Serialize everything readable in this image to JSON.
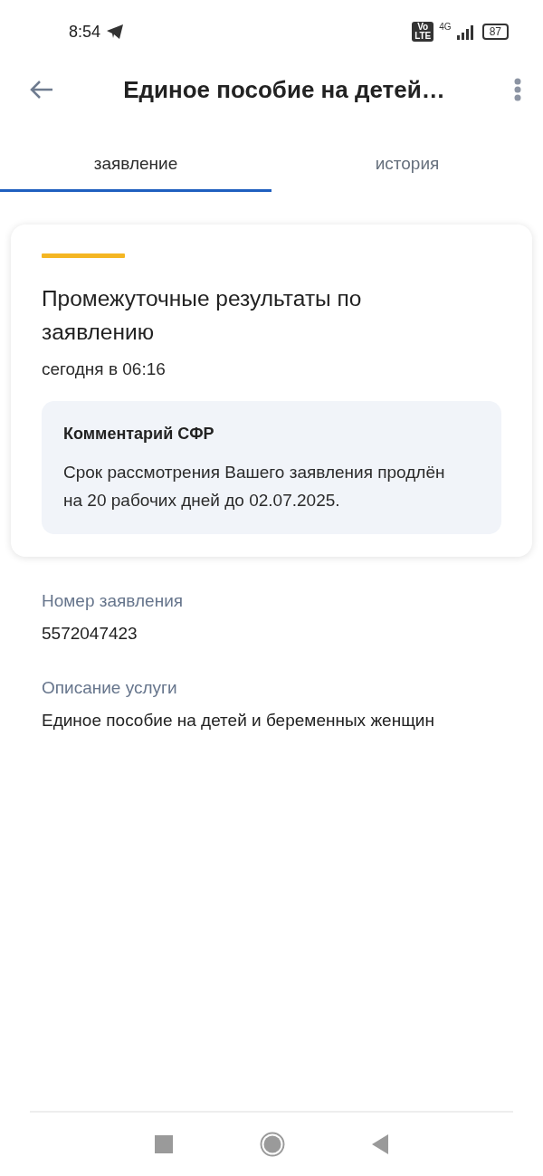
{
  "status_bar": {
    "time": "8:54",
    "volte": [
      "Vo",
      "LTE"
    ],
    "network": "4G",
    "battery": "87"
  },
  "header": {
    "title": "Единое пособие на детей…"
  },
  "tabs": [
    {
      "label": "заявление",
      "selected": true
    },
    {
      "label": "история",
      "selected": false
    }
  ],
  "status_card": {
    "title": "Промежуточные результаты по заявлению",
    "time": "сегодня в 06:16",
    "comment": {
      "title": "Комментарий СФР",
      "text": "Срок рассмотрения Вашего заявления продлён на 20 рабочих дней до 02.07.2025."
    }
  },
  "fields": [
    {
      "label": "Номер заявления",
      "value": "5572047423"
    },
    {
      "label": "Описание услуги",
      "value": "Единое пособие на детей и беременных женщин"
    }
  ]
}
